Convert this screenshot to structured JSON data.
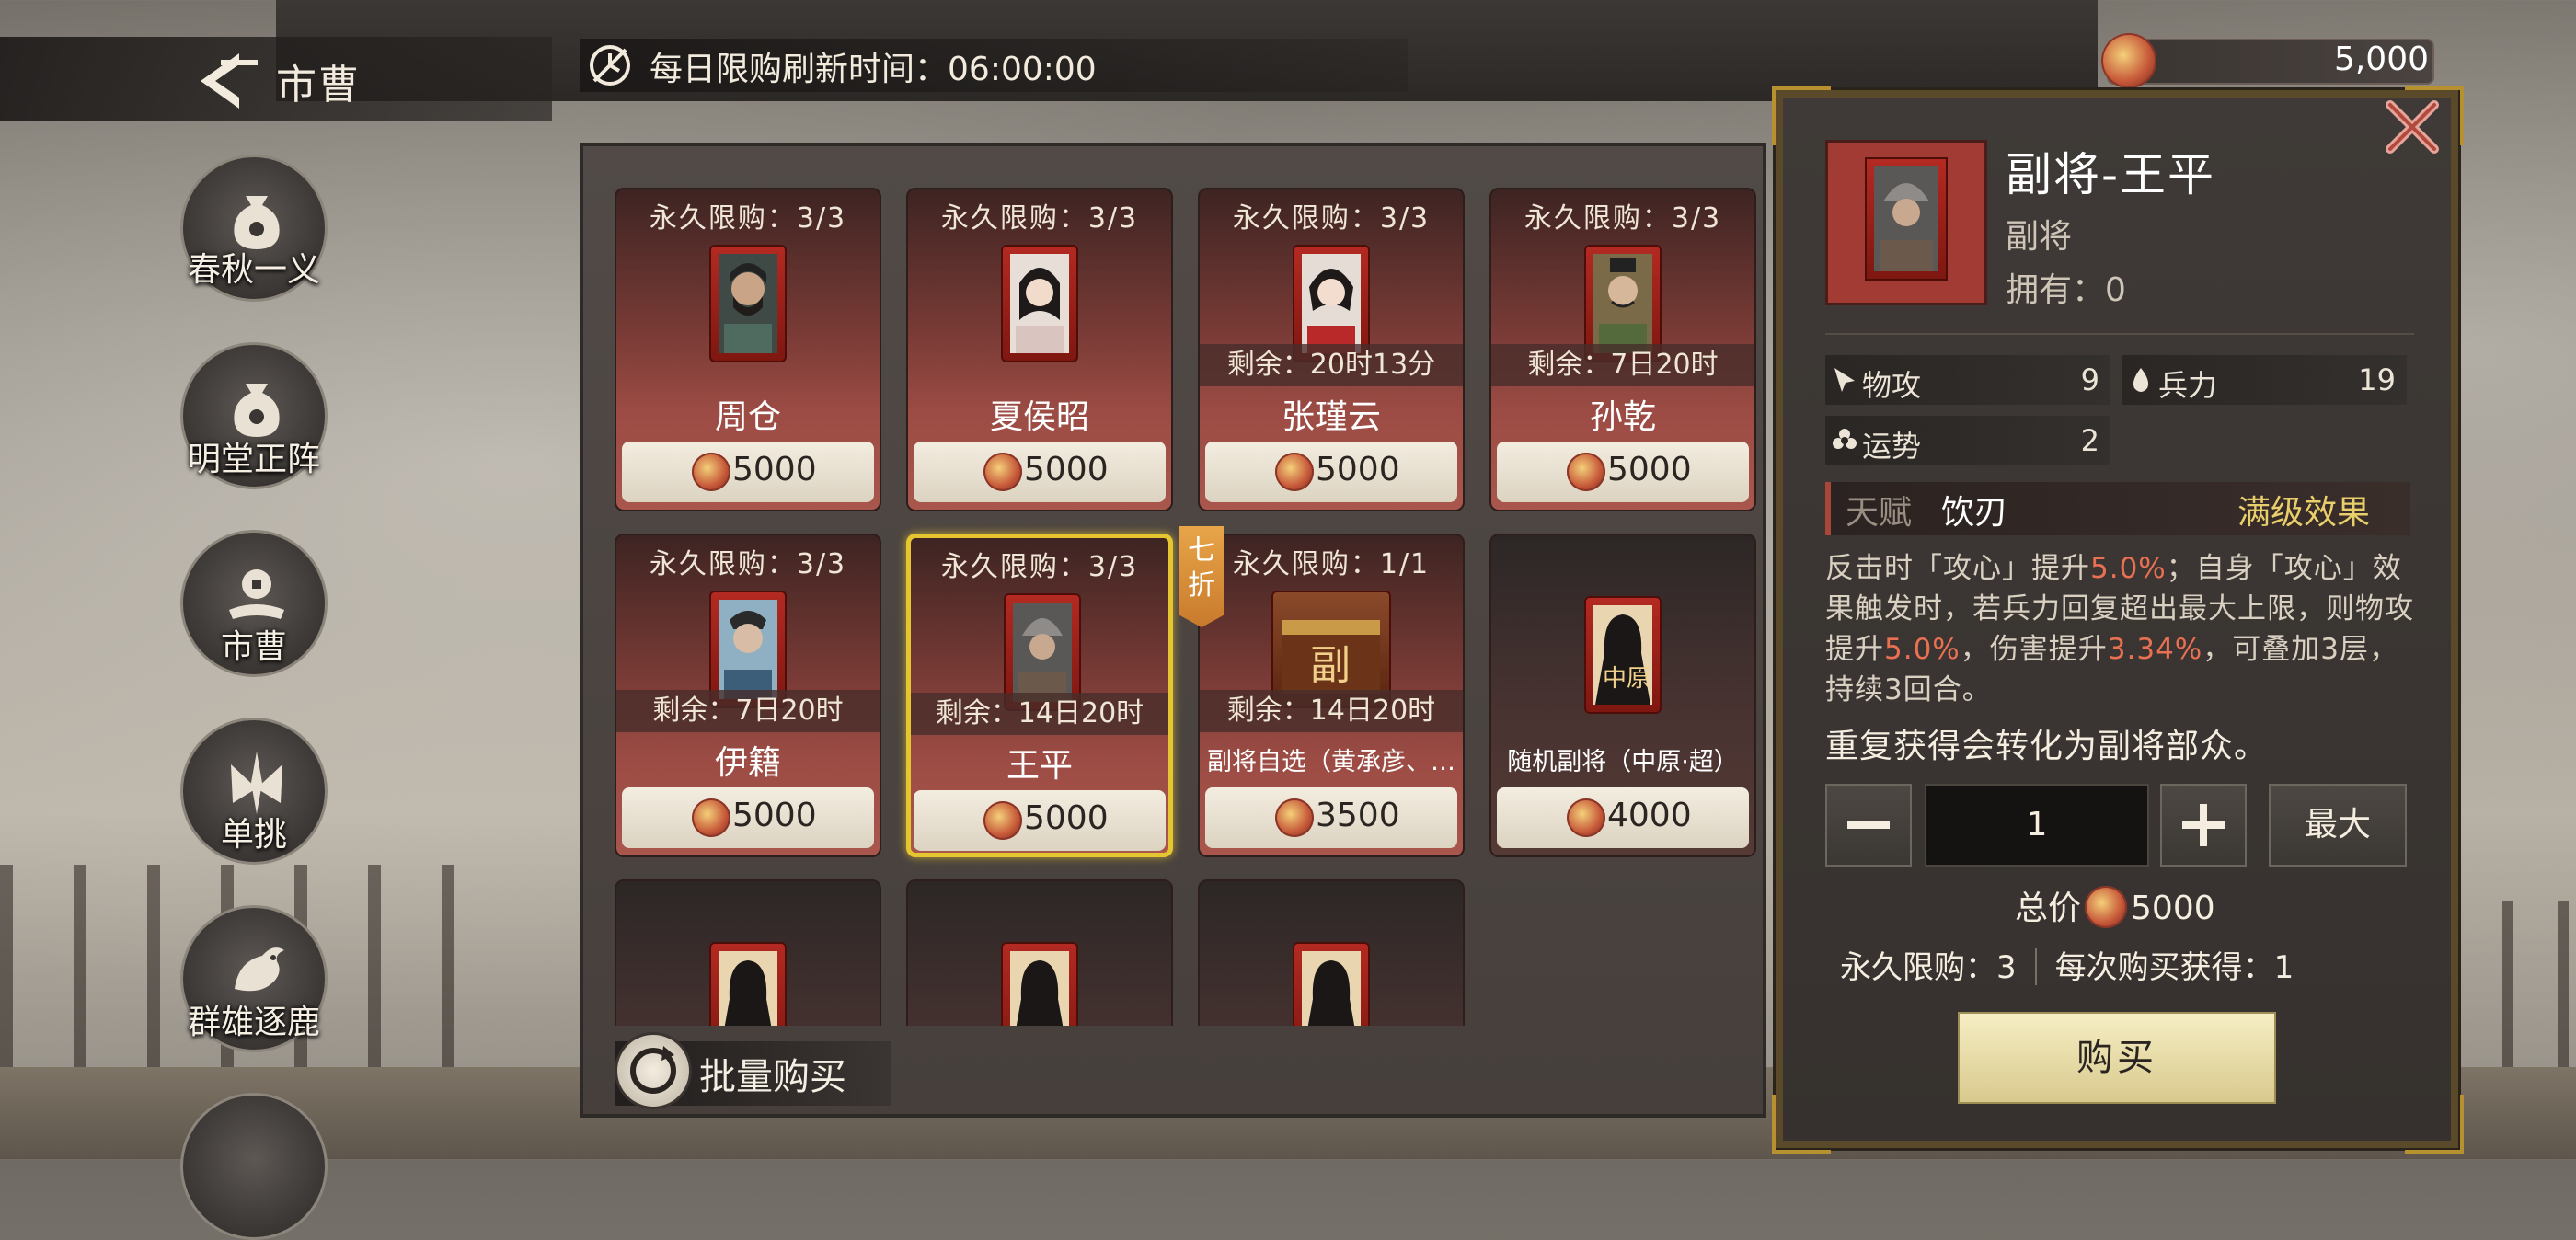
{
  "header": {
    "title": "市曹",
    "refresh_label": "每日限购刷新时间：",
    "refresh_time": "06:00:00",
    "currency_amount": "5,000"
  },
  "sidebar": {
    "items": [
      {
        "label": "春秋一义"
      },
      {
        "label": "明堂正阵"
      },
      {
        "label": "市曹"
      },
      {
        "label": "单挑"
      },
      {
        "label": "群雄逐鹿"
      }
    ]
  },
  "shop": {
    "cards": [
      {
        "limit": "永久限购：3/3",
        "name": "周仓",
        "price": "5000",
        "timer": ""
      },
      {
        "limit": "永久限购：3/3",
        "name": "夏侯昭",
        "price": "5000",
        "timer": ""
      },
      {
        "limit": "永久限购：3/3",
        "name": "张瑾云",
        "price": "5000",
        "timer": "剩余：20时13分"
      },
      {
        "limit": "永久限购：3/3",
        "name": "孙乾",
        "price": "5000",
        "timer": "剩余：7日20时"
      },
      {
        "limit": "永久限购：3/3",
        "name": "伊籍",
        "price": "5000",
        "timer": "剩余：7日20时"
      },
      {
        "limit": "永久限购：3/3",
        "name": "王平",
        "price": "5000",
        "timer": "剩余：14日20时"
      },
      {
        "limit": "永久限购：1/1",
        "name": "副将自选（黄承彦、…",
        "price": "3500",
        "timer": "剩余：14日20时"
      },
      {
        "limit": "",
        "name": "随机副将（中原·超）",
        "price": "4000",
        "timer": ""
      }
    ],
    "discount_badge": "七折",
    "card6_tag": "副",
    "card8_tag": "中原",
    "bulk_buy_label": "批量购买"
  },
  "detail": {
    "name": "副将-王平",
    "type": "副将",
    "owned": "拥有：0",
    "stats": {
      "attack_label": "物攻",
      "attack_value": "9",
      "troops_label": "兵力",
      "troops_value": "19",
      "luck_label": "运势",
      "luck_value": "2"
    },
    "talent_label": "天赋",
    "talent_name": "饮刃",
    "talent_max": "满级效果",
    "desc": {
      "p1": "反击时「攻心」提升",
      "v1": "5.0%",
      "p2": "；自身「攻心」效果触发时，若兵力回复超出最大上限，则物攻提升",
      "v2": "5.0%",
      "p3": "，伤害提升",
      "v3": "3.34%",
      "p4": "，可叠加3层，持续3回合。"
    },
    "duplicate_note": "重复获得会转化为副将部众。",
    "quantity": "1",
    "max_label": "最大",
    "total_label": "总价",
    "total_value": "5000",
    "perm_limit": "永久限购：3",
    "per_buy": "每次购买获得：1",
    "buy_label": "购买"
  },
  "colors": {
    "accent_gold": "#e6c630",
    "highlight_red": "#ea7052",
    "card_red": "#9c4c44"
  }
}
